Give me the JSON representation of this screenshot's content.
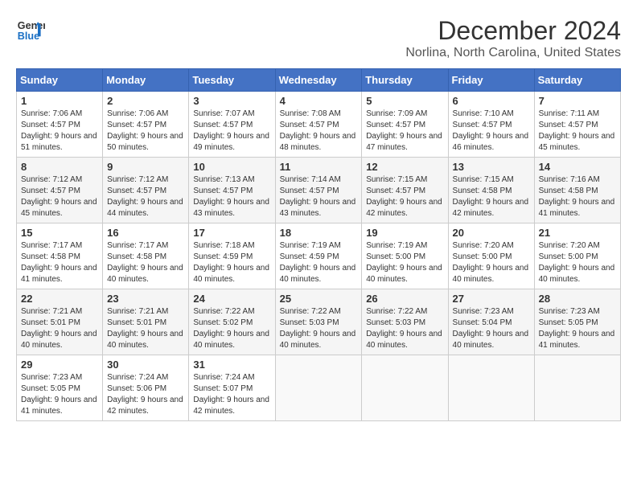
{
  "header": {
    "logo_line1": "General",
    "logo_line2": "Blue",
    "month_title": "December 2024",
    "location": "Norlina, North Carolina, United States"
  },
  "days_of_week": [
    "Sunday",
    "Monday",
    "Tuesday",
    "Wednesday",
    "Thursday",
    "Friday",
    "Saturday"
  ],
  "weeks": [
    [
      {
        "day": "1",
        "sunrise": "7:06 AM",
        "sunset": "4:57 PM",
        "daylight": "9 hours and 51 minutes."
      },
      {
        "day": "2",
        "sunrise": "7:06 AM",
        "sunset": "4:57 PM",
        "daylight": "9 hours and 50 minutes."
      },
      {
        "day": "3",
        "sunrise": "7:07 AM",
        "sunset": "4:57 PM",
        "daylight": "9 hours and 49 minutes."
      },
      {
        "day": "4",
        "sunrise": "7:08 AM",
        "sunset": "4:57 PM",
        "daylight": "9 hours and 48 minutes."
      },
      {
        "day": "5",
        "sunrise": "7:09 AM",
        "sunset": "4:57 PM",
        "daylight": "9 hours and 47 minutes."
      },
      {
        "day": "6",
        "sunrise": "7:10 AM",
        "sunset": "4:57 PM",
        "daylight": "9 hours and 46 minutes."
      },
      {
        "day": "7",
        "sunrise": "7:11 AM",
        "sunset": "4:57 PM",
        "daylight": "9 hours and 45 minutes."
      }
    ],
    [
      {
        "day": "8",
        "sunrise": "7:12 AM",
        "sunset": "4:57 PM",
        "daylight": "9 hours and 45 minutes."
      },
      {
        "day": "9",
        "sunrise": "7:12 AM",
        "sunset": "4:57 PM",
        "daylight": "9 hours and 44 minutes."
      },
      {
        "day": "10",
        "sunrise": "7:13 AM",
        "sunset": "4:57 PM",
        "daylight": "9 hours and 43 minutes."
      },
      {
        "day": "11",
        "sunrise": "7:14 AM",
        "sunset": "4:57 PM",
        "daylight": "9 hours and 43 minutes."
      },
      {
        "day": "12",
        "sunrise": "7:15 AM",
        "sunset": "4:57 PM",
        "daylight": "9 hours and 42 minutes."
      },
      {
        "day": "13",
        "sunrise": "7:15 AM",
        "sunset": "4:58 PM",
        "daylight": "9 hours and 42 minutes."
      },
      {
        "day": "14",
        "sunrise": "7:16 AM",
        "sunset": "4:58 PM",
        "daylight": "9 hours and 41 minutes."
      }
    ],
    [
      {
        "day": "15",
        "sunrise": "7:17 AM",
        "sunset": "4:58 PM",
        "daylight": "9 hours and 41 minutes."
      },
      {
        "day": "16",
        "sunrise": "7:17 AM",
        "sunset": "4:58 PM",
        "daylight": "9 hours and 40 minutes."
      },
      {
        "day": "17",
        "sunrise": "7:18 AM",
        "sunset": "4:59 PM",
        "daylight": "9 hours and 40 minutes."
      },
      {
        "day": "18",
        "sunrise": "7:19 AM",
        "sunset": "4:59 PM",
        "daylight": "9 hours and 40 minutes."
      },
      {
        "day": "19",
        "sunrise": "7:19 AM",
        "sunset": "5:00 PM",
        "daylight": "9 hours and 40 minutes."
      },
      {
        "day": "20",
        "sunrise": "7:20 AM",
        "sunset": "5:00 PM",
        "daylight": "9 hours and 40 minutes."
      },
      {
        "day": "21",
        "sunrise": "7:20 AM",
        "sunset": "5:00 PM",
        "daylight": "9 hours and 40 minutes."
      }
    ],
    [
      {
        "day": "22",
        "sunrise": "7:21 AM",
        "sunset": "5:01 PM",
        "daylight": "9 hours and 40 minutes."
      },
      {
        "day": "23",
        "sunrise": "7:21 AM",
        "sunset": "5:01 PM",
        "daylight": "9 hours and 40 minutes."
      },
      {
        "day": "24",
        "sunrise": "7:22 AM",
        "sunset": "5:02 PM",
        "daylight": "9 hours and 40 minutes."
      },
      {
        "day": "25",
        "sunrise": "7:22 AM",
        "sunset": "5:03 PM",
        "daylight": "9 hours and 40 minutes."
      },
      {
        "day": "26",
        "sunrise": "7:22 AM",
        "sunset": "5:03 PM",
        "daylight": "9 hours and 40 minutes."
      },
      {
        "day": "27",
        "sunrise": "7:23 AM",
        "sunset": "5:04 PM",
        "daylight": "9 hours and 40 minutes."
      },
      {
        "day": "28",
        "sunrise": "7:23 AM",
        "sunset": "5:05 PM",
        "daylight": "9 hours and 41 minutes."
      }
    ],
    [
      {
        "day": "29",
        "sunrise": "7:23 AM",
        "sunset": "5:05 PM",
        "daylight": "9 hours and 41 minutes."
      },
      {
        "day": "30",
        "sunrise": "7:24 AM",
        "sunset": "5:06 PM",
        "daylight": "9 hours and 42 minutes."
      },
      {
        "day": "31",
        "sunrise": "7:24 AM",
        "sunset": "5:07 PM",
        "daylight": "9 hours and 42 minutes."
      },
      null,
      null,
      null,
      null
    ]
  ],
  "labels": {
    "sunrise": "Sunrise:",
    "sunset": "Sunset:",
    "daylight": "Daylight:"
  }
}
